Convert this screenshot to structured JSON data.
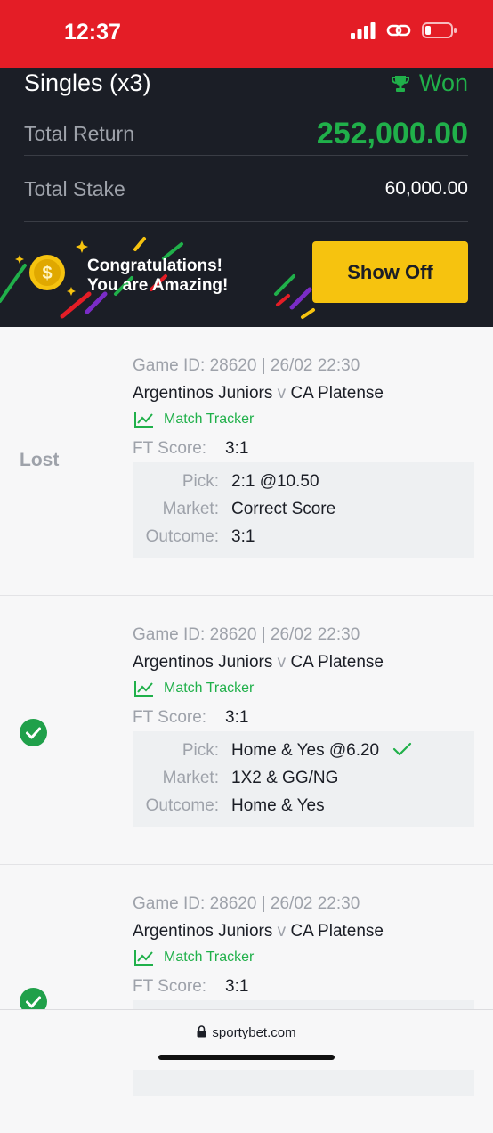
{
  "status_bar": {
    "time": "12:37"
  },
  "header": {
    "bet_type": "Singles (x3)",
    "status": "Won",
    "total_return_label": "Total Return",
    "total_return_value": "252,000.00",
    "total_stake_label": "Total Stake",
    "total_stake_value": "60,000.00"
  },
  "banner": {
    "line1": "Congratulations!",
    "line2": "You are Amazing!",
    "button": "Show Off"
  },
  "bets": [
    {
      "status": "Lost",
      "game_id": "Game ID: 28620 | 26/02 22:30",
      "home": "Argentinos Juniors",
      "v": "v",
      "away": "CA Platense",
      "tracker": "Match Tracker",
      "ft_label": "FT Score:",
      "ft_score": "3:1",
      "pick_label": "Pick:",
      "pick": "2:1 @10.50",
      "market_label": "Market:",
      "market": "Correct Score",
      "outcome_label": "Outcome:",
      "outcome": "3:1"
    },
    {
      "status": "won",
      "game_id": "Game ID: 28620 | 26/02 22:30",
      "home": "Argentinos Juniors",
      "v": "v",
      "away": "CA Platense",
      "tracker": "Match Tracker",
      "ft_label": "FT Score:",
      "ft_score": "3:1",
      "pick_label": "Pick:",
      "pick": "Home & Yes @6.20",
      "market_label": "Market:",
      "market": "1X2 & GG/NG",
      "outcome_label": "Outcome:",
      "outcome": "Home & Yes"
    },
    {
      "status": "won",
      "game_id": "Game ID: 28620 | 26/02 22:30",
      "home": "Argentinos Juniors",
      "v": "v",
      "away": "CA Platense",
      "tracker": "Match Tracker",
      "ft_label": "FT Score:",
      "ft_score": "3:1"
    }
  ],
  "browser": {
    "url": "sportybet.com"
  },
  "colors": {
    "brand_red": "#e41d26",
    "win_green": "#20b04a",
    "dark_bg": "#1b1e26",
    "accent_yellow": "#f6c30f"
  }
}
